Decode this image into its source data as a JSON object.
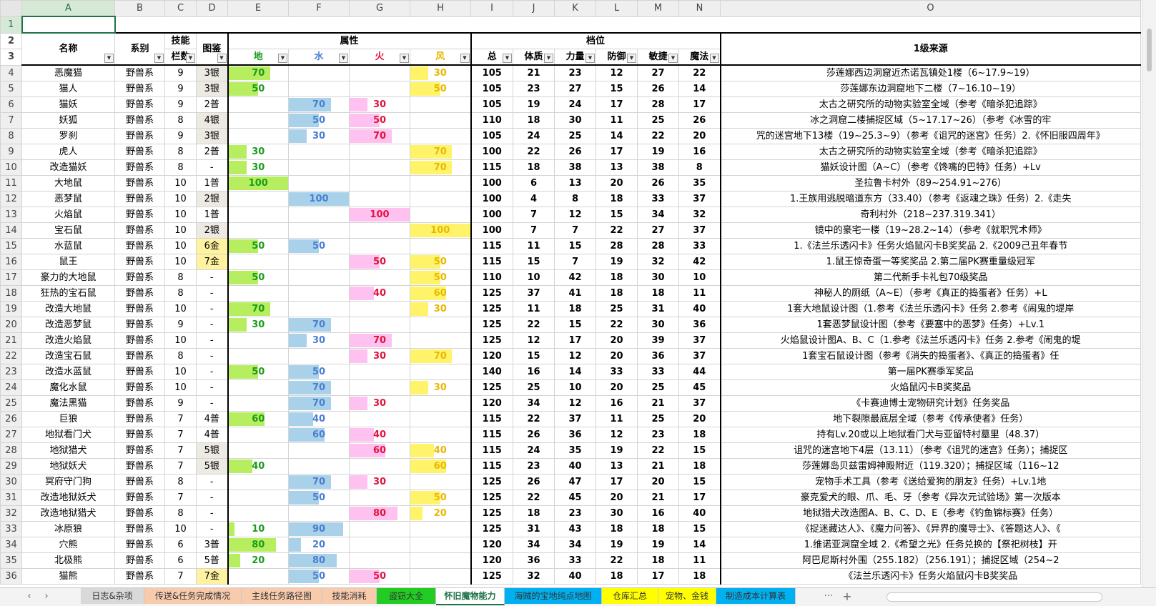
{
  "columns": [
    "A",
    "B",
    "C",
    "D",
    "E",
    "F",
    "G",
    "H",
    "I",
    "J",
    "K",
    "L",
    "M",
    "N",
    "O"
  ],
  "header": {
    "name": "名称",
    "series": "系别",
    "skill_slots_line1": "技能",
    "skill_slots_line2": "栏数",
    "codex": "图鉴",
    "attr_group": "属性",
    "earth": "地",
    "water": "水",
    "fire": "火",
    "wind": "风",
    "grade_group": "档位",
    "total": "总",
    "vit": "体质",
    "str": "力量",
    "def": "防御",
    "agi": "敏捷",
    "mag": "魔法",
    "source": "1级来源"
  },
  "rows": [
    {
      "r": "4",
      "name": "恶魔猫",
      "series": "野兽系",
      "slots": "9",
      "codex": "3银",
      "tier": "silver",
      "earth": "70",
      "water": "",
      "fire": "",
      "wind": "30",
      "total": "105",
      "vit": "21",
      "str": "23",
      "def": "12",
      "agi": "27",
      "mag": "22",
      "source": "莎莲娜西边洞窟近杰诺瓦镇处1楼（6~17.9~19）"
    },
    {
      "r": "5",
      "name": "猫人",
      "series": "野兽系",
      "slots": "9",
      "codex": "3银",
      "tier": "silver",
      "earth": "50",
      "water": "",
      "fire": "",
      "wind": "50",
      "total": "105",
      "vit": "23",
      "str": "27",
      "def": "15",
      "agi": "26",
      "mag": "14",
      "source": "莎莲娜东边洞窟地下二楼（7~16.10~19）"
    },
    {
      "r": "6",
      "name": "猫妖",
      "series": "野兽系",
      "slots": "9",
      "codex": "2普",
      "tier": "",
      "earth": "",
      "water": "70",
      "fire": "30",
      "wind": "",
      "total": "105",
      "vit": "19",
      "str": "24",
      "def": "17",
      "agi": "28",
      "mag": "17",
      "source": "太古之研究所的动物实验室全域（参考《暗杀犯追踪》"
    },
    {
      "r": "7",
      "name": "妖狐",
      "series": "野兽系",
      "slots": "8",
      "codex": "4银",
      "tier": "silver",
      "earth": "",
      "water": "50",
      "fire": "50",
      "wind": "",
      "total": "110",
      "vit": "18",
      "str": "30",
      "def": "11",
      "agi": "25",
      "mag": "26",
      "source": "冰之洞窟二楼捕捉区域（5~17.17~26）（参考《冰雪的牢"
    },
    {
      "r": "8",
      "name": "罗刹",
      "series": "野兽系",
      "slots": "9",
      "codex": "3银",
      "tier": "silver",
      "earth": "",
      "water": "30",
      "fire": "70",
      "wind": "",
      "total": "105",
      "vit": "24",
      "str": "25",
      "def": "14",
      "agi": "22",
      "mag": "20",
      "source": "咒的迷宫地下13楼（19~25.3~9）（参考《诅咒的迷宫》任务）2.《怀旧服四周年》"
    },
    {
      "r": "9",
      "name": "虎人",
      "series": "野兽系",
      "slots": "8",
      "codex": "2普",
      "tier": "",
      "earth": "30",
      "water": "",
      "fire": "",
      "wind": "70",
      "total": "100",
      "vit": "22",
      "str": "26",
      "def": "17",
      "agi": "19",
      "mag": "16",
      "source": "太古之研究所的动物实验室全域（参考《暗杀犯追踪》"
    },
    {
      "r": "10",
      "name": "改造猫妖",
      "series": "野兽系",
      "slots": "8",
      "codex": "-",
      "tier": "",
      "earth": "30",
      "water": "",
      "fire": "",
      "wind": "70",
      "total": "115",
      "vit": "18",
      "str": "38",
      "def": "13",
      "agi": "38",
      "mag": "8",
      "source": "猫妖设计图（A~C）（参考《馋嘴的巴特》任务）+Lv"
    },
    {
      "r": "11",
      "name": "大地鼠",
      "series": "野兽系",
      "slots": "10",
      "codex": "1普",
      "tier": "",
      "earth": "100",
      "water": "",
      "fire": "",
      "wind": "",
      "total": "100",
      "vit": "6",
      "str": "13",
      "def": "20",
      "agi": "26",
      "mag": "35",
      "source": "圣拉鲁卡村外（89~254.91~276）"
    },
    {
      "r": "12",
      "name": "恶梦鼠",
      "series": "野兽系",
      "slots": "10",
      "codex": "2银",
      "tier": "silver",
      "earth": "",
      "water": "100",
      "fire": "",
      "wind": "",
      "total": "100",
      "vit": "4",
      "str": "8",
      "def": "18",
      "agi": "33",
      "mag": "37",
      "source": "1.王族用逃脱暗道东方（33.40）（参考《返魂之珠》任务）2.《走失"
    },
    {
      "r": "13",
      "name": "火焰鼠",
      "series": "野兽系",
      "slots": "10",
      "codex": "1普",
      "tier": "",
      "earth": "",
      "water": "",
      "fire": "100",
      "wind": "",
      "total": "100",
      "vit": "7",
      "str": "12",
      "def": "15",
      "agi": "34",
      "mag": "32",
      "source": "奇利村外（218~237.319.341）"
    },
    {
      "r": "14",
      "name": "宝石鼠",
      "series": "野兽系",
      "slots": "10",
      "codex": "2银",
      "tier": "silver",
      "earth": "",
      "water": "",
      "fire": "",
      "wind": "100",
      "total": "100",
      "vit": "7",
      "str": "7",
      "def": "22",
      "agi": "27",
      "mag": "37",
      "source": "镜中的豪宅一楼（19~28.2~14）（参考《就职咒术师》"
    },
    {
      "r": "15",
      "name": "水蓝鼠",
      "series": "野兽系",
      "slots": "10",
      "codex": "6金",
      "tier": "gold",
      "earth": "50",
      "water": "50",
      "fire": "",
      "wind": "",
      "total": "115",
      "vit": "11",
      "str": "15",
      "def": "28",
      "agi": "28",
      "mag": "33",
      "source": "1.《法兰乐透闪卡》任务火焰鼠闪卡B奖奖品 2.《2009己丑年春节"
    },
    {
      "r": "16",
      "name": "鼠王",
      "series": "野兽系",
      "slots": "10",
      "codex": "7金",
      "tier": "gold",
      "earth": "",
      "water": "",
      "fire": "50",
      "wind": "50",
      "total": "115",
      "vit": "15",
      "str": "7",
      "def": "19",
      "agi": "32",
      "mag": "42",
      "source": "1.鼠王惊奇蛋一等奖奖品 2.第二届PK赛重量级冠军"
    },
    {
      "r": "17",
      "name": "豪力的大地鼠",
      "series": "野兽系",
      "slots": "8",
      "codex": "-",
      "tier": "",
      "earth": "50",
      "water": "",
      "fire": "",
      "wind": "50",
      "total": "110",
      "vit": "10",
      "str": "42",
      "def": "18",
      "agi": "30",
      "mag": "10",
      "source": "第二代新手卡礼包70级奖品"
    },
    {
      "r": "18",
      "name": "狂热的宝石鼠",
      "series": "野兽系",
      "slots": "8",
      "codex": "-",
      "tier": "",
      "earth": "",
      "water": "",
      "fire": "40",
      "wind": "60",
      "total": "125",
      "vit": "37",
      "str": "41",
      "def": "18",
      "agi": "18",
      "mag": "11",
      "source": "神秘人的厕纸（A~E）（参考《真正的捣蛋者》任务）+L"
    },
    {
      "r": "19",
      "name": "改造大地鼠",
      "series": "野兽系",
      "slots": "10",
      "codex": "-",
      "tier": "",
      "earth": "70",
      "water": "",
      "fire": "",
      "wind": "30",
      "total": "125",
      "vit": "11",
      "str": "18",
      "def": "25",
      "agi": "31",
      "mag": "40",
      "source": "1套大地鼠设计图（1.参考《法兰乐透闪卡》任务 2.参考《闹鬼的堤岸"
    },
    {
      "r": "20",
      "name": "改造恶梦鼠",
      "series": "野兽系",
      "slots": "9",
      "codex": "-",
      "tier": "",
      "earth": "30",
      "water": "70",
      "fire": "",
      "wind": "",
      "total": "125",
      "vit": "22",
      "str": "15",
      "def": "22",
      "agi": "30",
      "mag": "36",
      "source": "1套恶梦鼠设计图（参考《要塞中的恶梦》任务）+Lv.1"
    },
    {
      "r": "21",
      "name": "改造火焰鼠",
      "series": "野兽系",
      "slots": "10",
      "codex": "-",
      "tier": "",
      "earth": "",
      "water": "30",
      "fire": "70",
      "wind": "",
      "total": "125",
      "vit": "12",
      "str": "17",
      "def": "20",
      "agi": "39",
      "mag": "37",
      "source": "火焰鼠设计图A、B、C（1.参考《法兰乐透闪卡》任务 2.参考《闹鬼的堤"
    },
    {
      "r": "22",
      "name": "改造宝石鼠",
      "series": "野兽系",
      "slots": "8",
      "codex": "-",
      "tier": "",
      "earth": "",
      "water": "",
      "fire": "30",
      "wind": "70",
      "total": "120",
      "vit": "15",
      "str": "12",
      "def": "20",
      "agi": "36",
      "mag": "37",
      "source": "1套宝石鼠设计图（参考《消失的捣蛋者》、《真正的捣蛋者》任"
    },
    {
      "r": "23",
      "name": "改造水蓝鼠",
      "series": "野兽系",
      "slots": "10",
      "codex": "-",
      "tier": "",
      "earth": "50",
      "water": "50",
      "fire": "",
      "wind": "",
      "total": "140",
      "vit": "16",
      "str": "14",
      "def": "33",
      "agi": "33",
      "mag": "44",
      "source": "第一届PK赛季军奖品"
    },
    {
      "r": "24",
      "name": "魔化水鼠",
      "series": "野兽系",
      "slots": "10",
      "codex": "-",
      "tier": "",
      "earth": "",
      "water": "70",
      "fire": "",
      "wind": "30",
      "total": "125",
      "vit": "25",
      "str": "10",
      "def": "20",
      "agi": "25",
      "mag": "45",
      "source": "火焰鼠闪卡B奖奖品"
    },
    {
      "r": "25",
      "name": "魔法黑猫",
      "series": "野兽系",
      "slots": "9",
      "codex": "-",
      "tier": "",
      "earth": "",
      "water": "70",
      "fire": "30",
      "wind": "",
      "total": "120",
      "vit": "34",
      "str": "12",
      "def": "16",
      "agi": "21",
      "mag": "37",
      "source": "《卡赛迪博士宠物研究计划》任务奖品"
    },
    {
      "r": "26",
      "name": "巨狼",
      "series": "野兽系",
      "slots": "7",
      "codex": "4普",
      "tier": "",
      "earth": "60",
      "water": "40",
      "fire": "",
      "wind": "",
      "total": "115",
      "vit": "22",
      "str": "37",
      "def": "11",
      "agi": "25",
      "mag": "20",
      "source": "地下裂隙最底层全域（参考《传承使者》任务）"
    },
    {
      "r": "27",
      "name": "地狱看门犬",
      "series": "野兽系",
      "slots": "7",
      "codex": "4普",
      "tier": "",
      "earth": "",
      "water": "60",
      "fire": "40",
      "wind": "",
      "total": "115",
      "vit": "26",
      "str": "36",
      "def": "12",
      "agi": "23",
      "mag": "18",
      "source": "持有Lv.20或以上地狱看门犬与亚留特村墓里（48.37）"
    },
    {
      "r": "28",
      "name": "地狱猎犬",
      "series": "野兽系",
      "slots": "7",
      "codex": "5银",
      "tier": "silver",
      "earth": "",
      "water": "",
      "fire": "60",
      "wind": "40",
      "total": "115",
      "vit": "24",
      "str": "35",
      "def": "19",
      "agi": "22",
      "mag": "15",
      "source": "诅咒的迷宫地下4层（13.11）（参考《诅咒的迷宫》任务）；捕捉区"
    },
    {
      "r": "29",
      "name": "地狱妖犬",
      "series": "野兽系",
      "slots": "7",
      "codex": "5银",
      "tier": "silver",
      "earth": "40",
      "water": "",
      "fire": "",
      "wind": "60",
      "total": "115",
      "vit": "23",
      "str": "40",
      "def": "13",
      "agi": "21",
      "mag": "18",
      "source": "莎莲娜岛贝兹雷姆神殿附近（119.320）；捕捉区域（116~12"
    },
    {
      "r": "30",
      "name": "冥府守门狗",
      "series": "野兽系",
      "slots": "8",
      "codex": "-",
      "tier": "",
      "earth": "",
      "water": "70",
      "fire": "30",
      "wind": "",
      "total": "125",
      "vit": "26",
      "str": "47",
      "def": "17",
      "agi": "20",
      "mag": "15",
      "source": "宠物手术工具（参考《送给爱狗的朋友》任务）+Lv.1地"
    },
    {
      "r": "31",
      "name": "改造地狱妖犬",
      "series": "野兽系",
      "slots": "7",
      "codex": "-",
      "tier": "",
      "earth": "",
      "water": "50",
      "fire": "",
      "wind": "50",
      "total": "125",
      "vit": "22",
      "str": "45",
      "def": "20",
      "agi": "21",
      "mag": "17",
      "source": "豪克爱犬的眼、爪、毛、牙（参考《异次元试验场》第一次版本"
    },
    {
      "r": "32",
      "name": "改造地狱猎犬",
      "series": "野兽系",
      "slots": "8",
      "codex": "-",
      "tier": "",
      "earth": "",
      "water": "",
      "fire": "80",
      "wind": "20",
      "total": "125",
      "vit": "18",
      "str": "23",
      "def": "30",
      "agi": "16",
      "mag": "40",
      "source": "地狱猎犬改造图A、B、C、D、E（参考《钓鱼锦标赛》任务）"
    },
    {
      "r": "33",
      "name": "冰原狼",
      "series": "野兽系",
      "slots": "10",
      "codex": "-",
      "tier": "",
      "earth": "10",
      "water": "90",
      "fire": "",
      "wind": "",
      "total": "125",
      "vit": "31",
      "str": "43",
      "def": "18",
      "agi": "18",
      "mag": "15",
      "source": "《捉迷藏达人》、《魔力问答》、《异界的魔导士》、《答题达人》、《"
    },
    {
      "r": "34",
      "name": "穴熊",
      "series": "野兽系",
      "slots": "6",
      "codex": "3普",
      "tier": "",
      "earth": "80",
      "water": "20",
      "fire": "",
      "wind": "",
      "total": "120",
      "vit": "34",
      "str": "34",
      "def": "19",
      "agi": "19",
      "mag": "14",
      "source": "1.维诺亚洞窟全域 2.《希望之光》任务兑换的【祭祀树枝】开"
    },
    {
      "r": "35",
      "name": "北极熊",
      "series": "野兽系",
      "slots": "6",
      "codex": "5普",
      "tier": "",
      "earth": "20",
      "water": "80",
      "fire": "",
      "wind": "",
      "total": "120",
      "vit": "36",
      "str": "33",
      "def": "22",
      "agi": "18",
      "mag": "11",
      "source": "阿巴尼斯村外围（255.182）（256.191）；捕捉区域（254~2"
    },
    {
      "r": "36",
      "name": "猫熊",
      "series": "野兽系",
      "slots": "7",
      "codex": "7金",
      "tier": "gold",
      "earth": "",
      "water": "50",
      "fire": "50",
      "wind": "",
      "total": "125",
      "vit": "32",
      "str": "40",
      "def": "18",
      "agi": "17",
      "mag": "18",
      "source": "《法兰乐透闪卡》任务火焰鼠闪卡B奖奖品"
    }
  ],
  "tabs": [
    {
      "label": "日志&杂项",
      "color": "#d9d9d9"
    },
    {
      "label": "传送&任务完成情况",
      "color": "#f8cbad"
    },
    {
      "label": "主线任务路径图",
      "color": "#f8cbad"
    },
    {
      "label": "技能消耗",
      "color": "#f8cbad"
    },
    {
      "label": "盗窃大全",
      "color": "#22cc22"
    },
    {
      "label": "怀旧魔物能力",
      "color": "#ffffff"
    },
    {
      "label": "海贼的宝地纯点地图",
      "color": "#00b0f0"
    },
    {
      "label": "仓库汇总",
      "color": "#ffff00"
    },
    {
      "label": "宠物、金钱",
      "color": "#ffff00"
    },
    {
      "label": "制造成本计算表",
      "color": "#00b0f0"
    }
  ],
  "active_tab": "怀旧魔物能力",
  "more_tabs": "···",
  "add_tab": "+",
  "nav_prev": "‹",
  "nav_next": "›"
}
